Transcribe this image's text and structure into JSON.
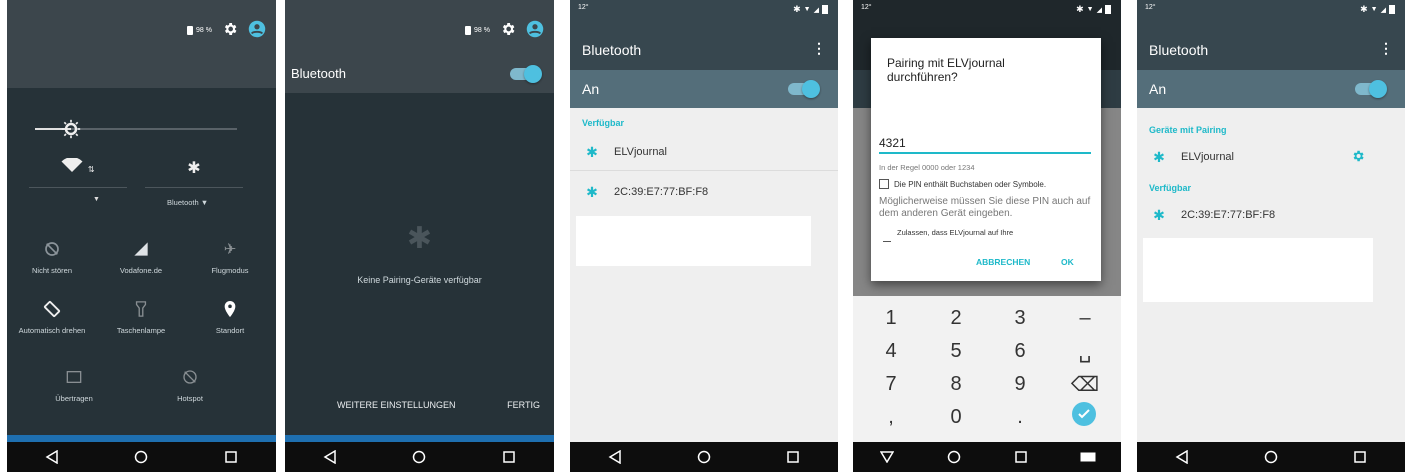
{
  "p1": {
    "battery": "98 %",
    "tiles": [
      {
        "label": "Nicht stören",
        "icon": "dnd-off-icon"
      },
      {
        "label": "Vodafone.de",
        "icon": "signal-icon"
      },
      {
        "label": "Flugmodus",
        "icon": "airplane-icon"
      },
      {
        "label": "Automatisch drehen",
        "icon": "rotate-icon"
      },
      {
        "label": "Taschenlampe",
        "icon": "flashlight-icon"
      },
      {
        "label": "Standort",
        "icon": "location-icon"
      },
      {
        "label": "Übertragen",
        "icon": "cast-icon"
      },
      {
        "label": "Hotspot",
        "icon": "hotspot-icon"
      }
    ],
    "bluetooth_label": "Bluetooth"
  },
  "p2": {
    "battery": "98 %",
    "title": "Bluetooth",
    "empty": "Keine Pairing-Geräte verfügbar",
    "more": "WEITERE EINSTELLUNGEN",
    "done": "FERTIG"
  },
  "p3": {
    "time": "12°",
    "title": "Bluetooth",
    "on": "An",
    "available": "Verfügbar",
    "devices": [
      "ELVjournal",
      "2C:39:E7:77:BF:F8"
    ]
  },
  "p4": {
    "time": "12°",
    "dialog_title": "Pairing mit ELVjournal durchführen?",
    "pin": "4321",
    "hint": "In der Regel 0000 oder 1234",
    "pin_check": "Die PIN enthält Buchstaben oder Symbole.",
    "info": "Möglicherweise müssen Sie diese PIN auch auf dem anderen Gerät eingeben.",
    "allow": "Zulassen, dass ELVjournal auf Ihre",
    "cancel": "ABBRECHEN",
    "ok": "OK",
    "keys": [
      "1",
      "2",
      "3",
      "–",
      "4",
      "5",
      "6",
      "␣",
      "7",
      "8",
      "9",
      "⌫",
      ",",
      "0",
      "."
    ]
  },
  "p5": {
    "time": "12°",
    "title": "Bluetooth",
    "on": "An",
    "paired_header": "Geräte mit Pairing",
    "paired": "ELVjournal",
    "available": "Verfügbar",
    "device": "2C:39:E7:77:BF:F8"
  },
  "colors": {
    "accent": "#1eb9c9",
    "dark": "#263238",
    "toolbar": "#37474f"
  }
}
